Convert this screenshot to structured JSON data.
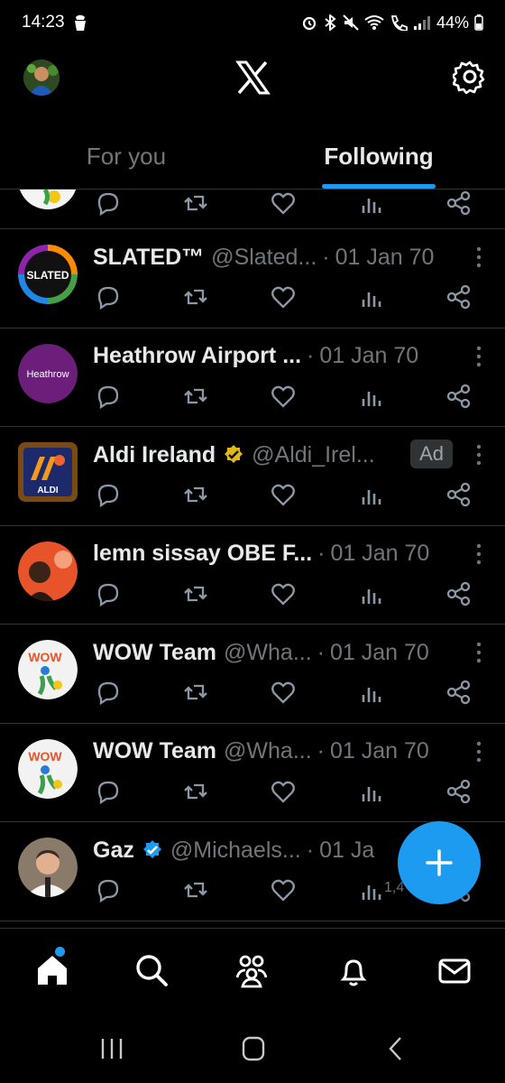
{
  "status_bar": {
    "time": "14:23",
    "battery": "44%"
  },
  "header": {
    "logo": "X",
    "icons": [
      "profile-avatar",
      "x-logo",
      "settings-gear-icon"
    ]
  },
  "tabs": [
    {
      "label": "For you",
      "active": false
    },
    {
      "label": "Following",
      "active": true
    }
  ],
  "tweets": [
    {
      "name": "SLATED™",
      "handle": "@Slated...",
      "date": "01 Jan 70",
      "views": ""
    },
    {
      "name": "Heathrow Airport ...",
      "handle": "",
      "date": "01 Jan 70",
      "views": ""
    },
    {
      "name": "Aldi Ireland",
      "handle": "@Aldi_Irel...",
      "date": "",
      "ad": "Ad",
      "views": ""
    },
    {
      "name": "lemn sissay OBE F...",
      "handle": "",
      "date": "01 Jan 70",
      "views": ""
    },
    {
      "name": "WOW Team",
      "handle": "@Wha...",
      "date": "01 Jan 70",
      "views": ""
    },
    {
      "name": "WOW Team",
      "handle": "@Wha...",
      "date": "01 Jan 70",
      "views": ""
    },
    {
      "name": "Gaz",
      "handle": "@Michaels...",
      "date": "01 Ja",
      "views": "1,4"
    }
  ],
  "avatars": {
    "slated_text": "SLATED",
    "heathrow_text": "Heathrow",
    "aldi_text": "ALDI",
    "wow_text": "WOW"
  },
  "bottom_nav": {
    "items": [
      "home-icon",
      "search-icon",
      "communities-icon",
      "notifications-icon",
      "messages-icon"
    ],
    "active": "home-icon"
  },
  "colors": {
    "accent": "#1d9bf0",
    "background": "#000000",
    "muted": "#71767b",
    "text": "#e7e9ea",
    "verified_gold": "#e2b719"
  }
}
